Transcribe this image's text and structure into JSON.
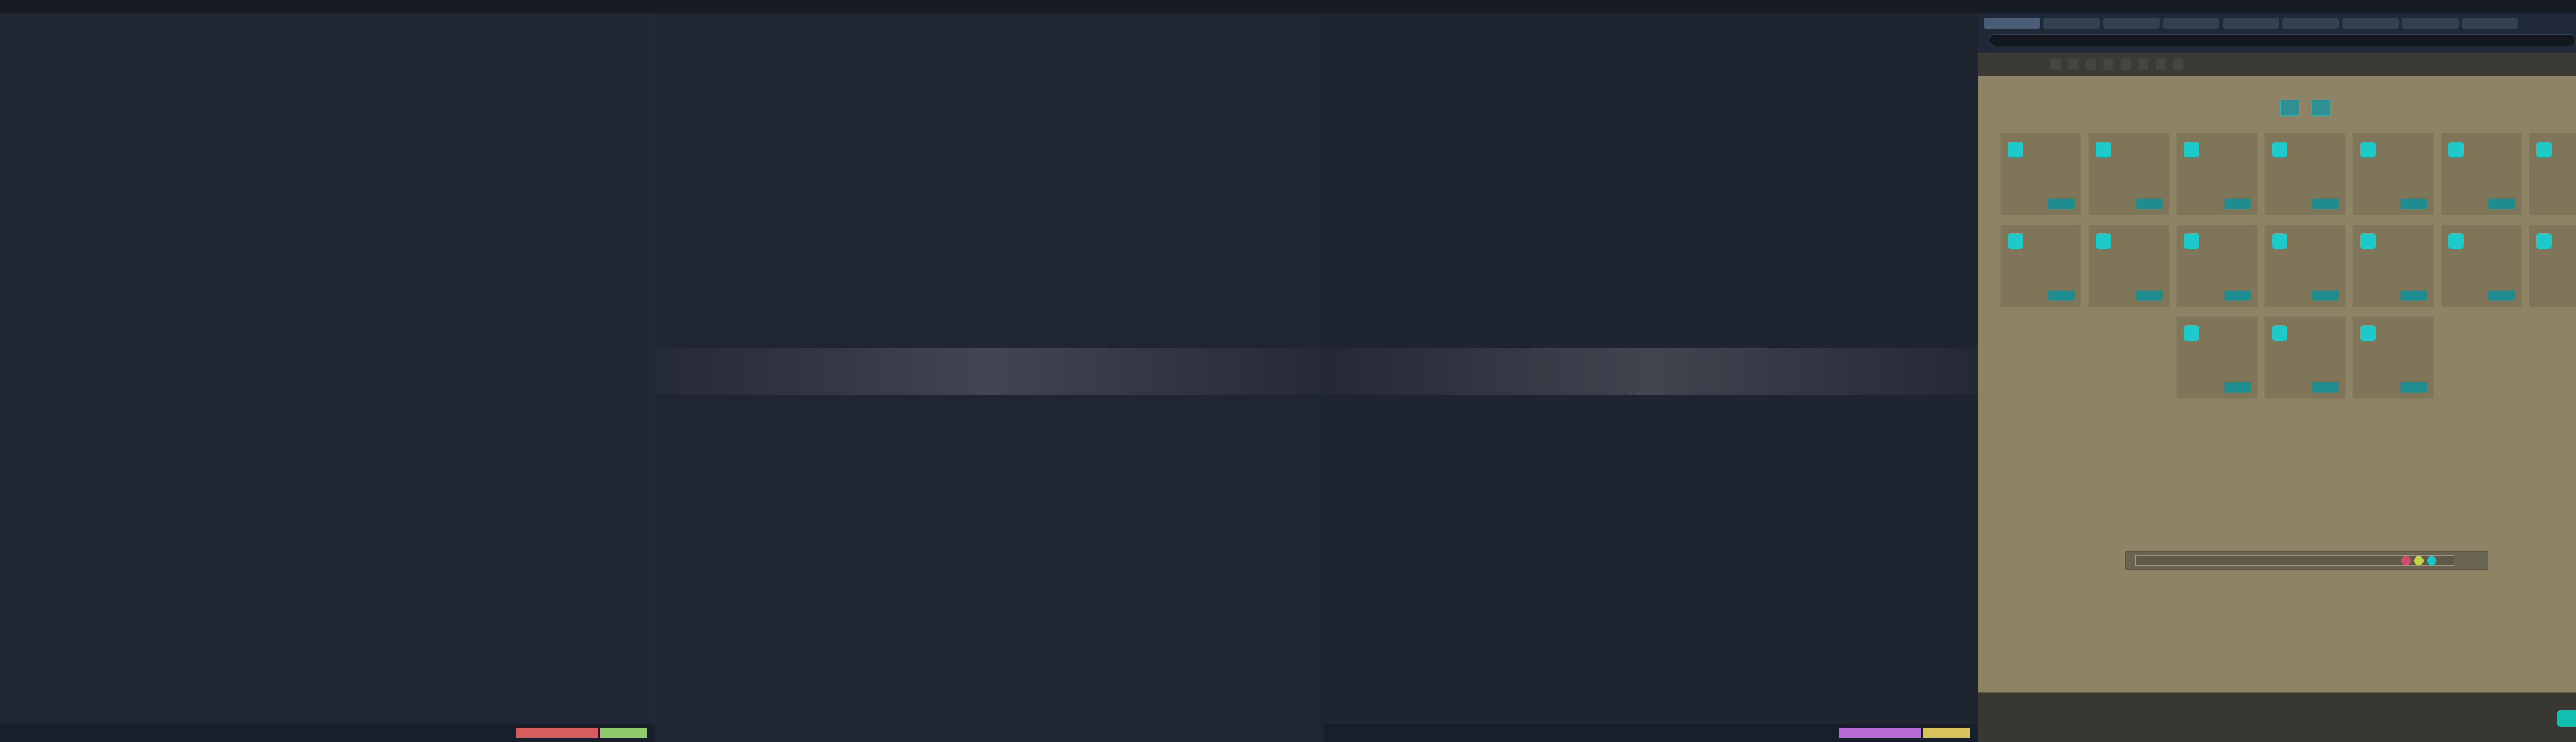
{
  "window": {
    "top_title": "",
    "top_right": ""
  },
  "terminals": [
    {
      "lines": [
        {
          "text": "",
          "tone": "red"
        },
        {
          "text": "",
          "tone": "red"
        },
        {
          "text": "",
          "tone": "red"
        },
        {
          "text": "",
          "tone": "red"
        },
        {
          "text": "",
          "tone": "yellow"
        },
        {
          "text": "",
          "tone": "white"
        },
        {
          "text": "",
          "tone": "blue"
        },
        {
          "text": "",
          "tone": "yellow"
        },
        {
          "text": "",
          "tone": "red"
        },
        {
          "text": "",
          "tone": "red"
        },
        {
          "text": "",
          "tone": "muted"
        },
        {
          "text": "",
          "tone": "yellow"
        },
        {
          "text": "",
          "tone": "muted"
        },
        {
          "text": "",
          "tone": "muted"
        },
        {
          "text": "",
          "tone": "muted"
        },
        {
          "text": "",
          "tone": "white"
        }
      ],
      "status": {
        "left": "",
        "mode1": "",
        "mode2": ""
      }
    },
    {
      "lines": [
        {
          "text": "",
          "tone": "green"
        },
        {
          "text": "",
          "tone": "blue"
        },
        {
          "text": "",
          "tone": "white"
        },
        {
          "text": "",
          "tone": "green"
        },
        {
          "text": "",
          "tone": "white"
        },
        {
          "text": "",
          "tone": "white"
        },
        {
          "text": "",
          "tone": "red"
        },
        {
          "text": "",
          "tone": "green"
        },
        {
          "text": "",
          "tone": "blue"
        },
        {
          "text": "",
          "tone": "red"
        },
        {
          "text": "",
          "tone": "white"
        },
        {
          "text": "",
          "tone": "red"
        },
        {
          "text": "",
          "tone": "blue"
        },
        {
          "text": "",
          "tone": "red"
        },
        {
          "text": "",
          "tone": "white"
        },
        {
          "text": "",
          "tone": "red"
        }
      ],
      "status": {
        "left": "",
        "mode1": "",
        "mode2": ""
      }
    },
    {
      "lines": [
        {
          "text": "",
          "tone": "muted"
        },
        {
          "text": "",
          "tone": "muted"
        },
        {
          "text": "",
          "tone": "muted"
        },
        {
          "text": "",
          "tone": "muted"
        },
        {
          "text": "",
          "tone": "muted"
        },
        {
          "text": "",
          "tone": "muted"
        },
        {
          "text": "",
          "tone": "muted"
        },
        {
          "text": "",
          "tone": "muted"
        }
      ],
      "status": {
        "left": "",
        "mode1": "",
        "mode2": ""
      }
    }
  ],
  "browser": {
    "tabs": [
      "",
      "",
      "",
      "",
      "",
      "",
      "",
      "",
      ""
    ],
    "address": "",
    "nav_items": [
      "",
      "",
      "",
      "",
      "",
      "",
      "",
      ""
    ],
    "hero_buttons": [
      "",
      ""
    ],
    "cards": [
      {
        "icon": "",
        "title": "",
        "button": ""
      },
      {
        "icon": "",
        "title": "",
        "button": ""
      },
      {
        "icon": "",
        "title": "",
        "button": ""
      },
      {
        "icon": "",
        "title": "",
        "button": ""
      },
      {
        "icon": "",
        "title": "",
        "button": ""
      },
      {
        "icon": "",
        "title": "",
        "button": ""
      },
      {
        "icon": "",
        "title": "",
        "button": ""
      },
      {
        "icon": "",
        "title": "",
        "button": ""
      },
      {
        "icon": "",
        "title": "",
        "button": ""
      },
      {
        "icon": "",
        "title": "",
        "button": ""
      },
      {
        "icon": "",
        "title": "",
        "button": ""
      },
      {
        "icon": "",
        "title": "",
        "button": ""
      },
      {
        "icon": "",
        "title": "",
        "button": ""
      },
      {
        "icon": "",
        "title": "",
        "button": ""
      },
      {
        "icon": "",
        "title": "",
        "button": ""
      },
      {
        "icon": "",
        "title": "",
        "button": ""
      },
      {
        "icon": "",
        "title": "",
        "button": ""
      }
    ],
    "center_link": "",
    "small_link": "",
    "search_placeholder": "",
    "footer_lines": [
      "",
      "",
      ""
    ],
    "footer_button": ""
  },
  "colors": {
    "terminal_background": "#202532",
    "browser_background": "#8e8465",
    "accent": "#1ec9ca"
  }
}
